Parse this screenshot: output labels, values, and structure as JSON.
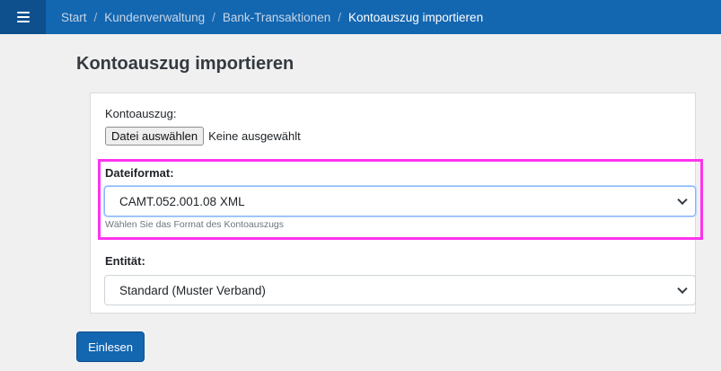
{
  "breadcrumb": {
    "items": [
      "Start",
      "Kundenverwaltung",
      "Bank-Transaktionen"
    ],
    "current": "Kontoauszug importieren",
    "separator": "/"
  },
  "page": {
    "title": "Kontoauszug importieren"
  },
  "form": {
    "file": {
      "label": "Kontoauszug:",
      "button_label": "Datei auswählen",
      "status": "Keine ausgewählt"
    },
    "format": {
      "label": "Dateiformat:",
      "selected": "CAMT.052.001.08 XML",
      "help": "Wählen Sie das Format des Kontoauszugs"
    },
    "entity": {
      "label": "Entität:",
      "selected": "Standard (Muster Verband)"
    },
    "submit_label": "Einlesen"
  },
  "colors": {
    "topbar": "#1366b0",
    "menu_button": "#0e4f8d",
    "highlight": "#ff33ee",
    "primary_button": "#1366b0"
  },
  "icons": {
    "menu": "hamburger-icon",
    "select_arrow": "chevron-down-icon"
  }
}
